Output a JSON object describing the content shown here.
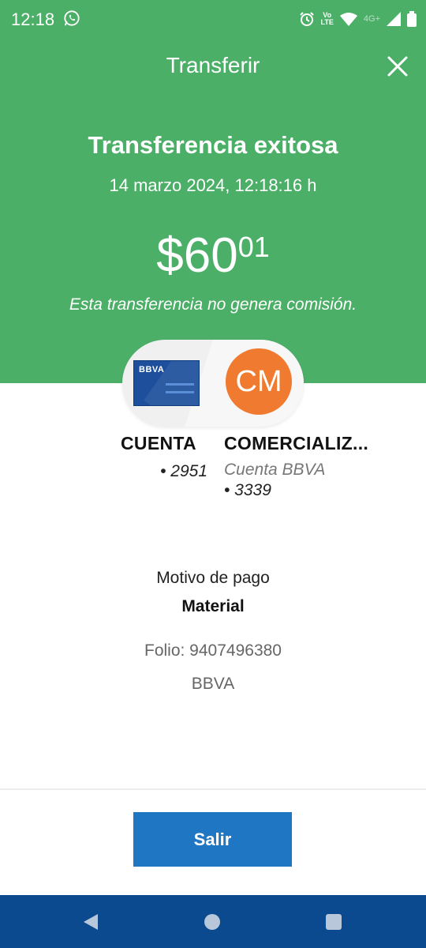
{
  "status_bar": {
    "time": "12:18",
    "icons": [
      "whatsapp-icon",
      "alarm-icon",
      "volte-icon",
      "wifi-icon",
      "signal-icon",
      "battery-icon"
    ],
    "volte_line1": "Vo",
    "volte_line2": "LTE",
    "network": "4G+"
  },
  "header": {
    "title": "Transferir",
    "close_icon": "close-icon"
  },
  "result": {
    "headline": "Transferencia exitosa",
    "datetime": "14 marzo 2024, 12:18:16 h",
    "amount_main": "$60",
    "amount_cents": "01",
    "commission_note": "Esta transferencia no genera comisión."
  },
  "from_account": {
    "card_brand": "BBVA",
    "name": "CUENTA",
    "number": "• 2951"
  },
  "to_account": {
    "initials": "CM",
    "name": "COMERCIALIZ...",
    "bank_label": "Cuenta BBVA",
    "number": "• 3339"
  },
  "details": {
    "motivo_label": "Motivo de pago",
    "motivo_value": "Material",
    "folio": "Folio: 9407496380",
    "bank": "BBVA"
  },
  "actions": {
    "exit_label": "Salir"
  },
  "colors": {
    "header_green": "#4caf68",
    "primary_button": "#1f77c4",
    "avatar_orange": "#f07a30",
    "navbar": "#0b4a8e"
  }
}
